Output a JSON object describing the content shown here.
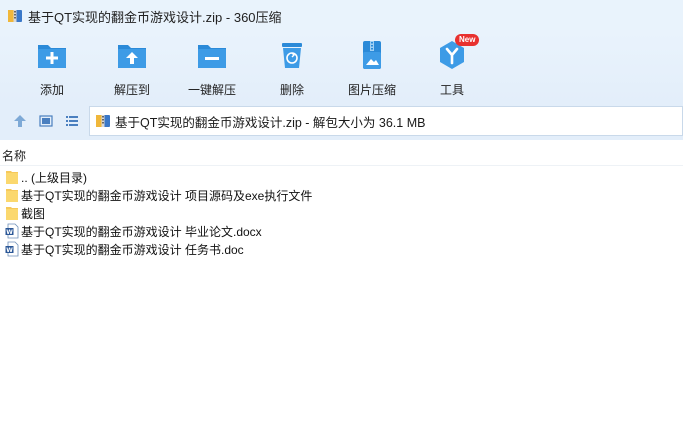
{
  "window": {
    "title": "基于QT实现的翻金币游戏设计.zip - 360压缩",
    "app_icon": "zip-archive-icon"
  },
  "toolbar": {
    "items": [
      {
        "label": "添加",
        "icon": "add-folder-icon"
      },
      {
        "label": "解压到",
        "icon": "extract-to-icon"
      },
      {
        "label": "一键解压",
        "icon": "one-click-extract-icon"
      },
      {
        "label": "删除",
        "icon": "delete-bin-icon"
      },
      {
        "label": "图片压缩",
        "icon": "image-compress-icon"
      },
      {
        "label": "工具",
        "icon": "tools-icon",
        "badge": "New"
      }
    ]
  },
  "address": {
    "path": "基于QT实现的翻金币游戏设计.zip - 解包大小为 36.1 MB"
  },
  "columns": {
    "name": "名称"
  },
  "files": [
    {
      "name": ".. (上级目录)",
      "type": "folder"
    },
    {
      "name": "基于QT实现的翻金币游戏设计 项目源码及exe执行文件",
      "type": "folder"
    },
    {
      "name": "截图",
      "type": "folder"
    },
    {
      "name": "基于QT实现的翻金币游戏设计 毕业论文.docx",
      "type": "word"
    },
    {
      "name": "基于QT实现的翻金币游戏设计 任务书.doc",
      "type": "word"
    }
  ],
  "colors": {
    "accent": "#2b8ad8",
    "toolbar_bg": "#e3eefa",
    "badge": "#e8312f",
    "folder": "#f6c95b"
  }
}
